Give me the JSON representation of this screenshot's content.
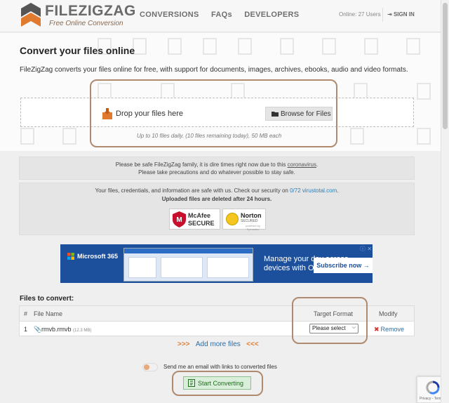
{
  "header": {
    "brand": "FILEZIGZAG",
    "tagline": "Free Online Conversion",
    "nav": [
      "CONVERSIONS",
      "FAQs",
      "DEVELOPERS"
    ],
    "online": "Online: 27 Users",
    "signin": "SIGN IN"
  },
  "hero": {
    "title": "Convert your files online",
    "description": "FileZigZag converts your files online for free, with support for documents, images, archives, ebooks, audio and video formats.",
    "drop_label": "Drop your files here",
    "browse_label": "Browse for Files",
    "limits": "Up to 10 files daily. (10 files remaining today), 50 MB each"
  },
  "notice": {
    "line1_prefix": "Please be safe FileZigZag family, it is dire times right now due to this ",
    "line1_link": "coronavirus",
    "line1_suffix": ".",
    "line2": "Please take precautions and do whatever possible to stay safe."
  },
  "security": {
    "line1_prefix": "Your files, credentials, and information are safe with us. Check our security on ",
    "score": "0/72",
    "site": "virustotal.com",
    "line1_suffix": ".",
    "line2": "Uploaded files are deleted after 24 hours.",
    "mcafee_1": "McAfee",
    "mcafee_2": "SECURE",
    "norton_1": "Norton",
    "norton_2": "SECURED",
    "norton_3": "powered by Symantec"
  },
  "ad": {
    "brand": "Microsoft 365",
    "msg1": "Manage your day across",
    "msg2": "devices with Outlook",
    "cta": "Subscribe now →",
    "close": "ⓘ ✕"
  },
  "files": {
    "title": "Files to convert:",
    "columns": [
      "#",
      "File Name",
      "Target Format",
      "Modify"
    ],
    "rows": [
      {
        "index": "1",
        "name": "rmvb.rmvb",
        "size": "(12.3 MB)",
        "format": "Please select",
        "action": "Remove"
      }
    ],
    "add_more": "Add more files",
    "chev_left": ">>>",
    "chev_right": "<<<"
  },
  "footer": {
    "email_label": "Send me an email with links to converted files",
    "start_label": "Start Converting",
    "recaptcha": "Privacy - Terms"
  },
  "colors": {
    "accent": "#e07a2f",
    "link": "#2e6da4",
    "highlight_ring": "#b08a6e",
    "ad_bg": "#1c4f9c"
  }
}
